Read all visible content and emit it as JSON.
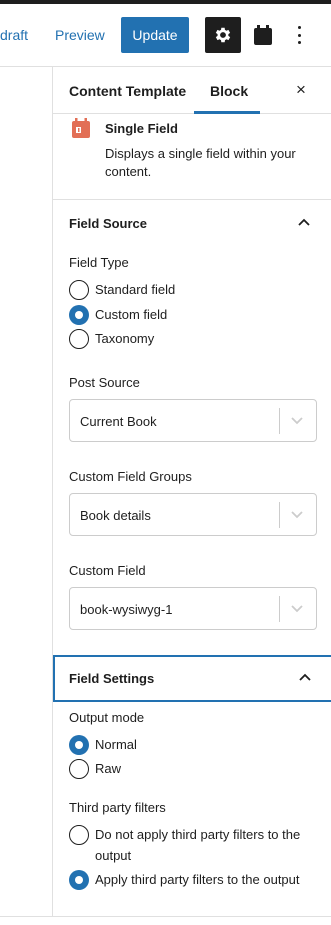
{
  "toolbar": {
    "draft_label": "draft",
    "preview_label": "Preview",
    "update_label": "Update"
  },
  "sidebar": {
    "tabs": [
      {
        "label": "Content Template",
        "active": false
      },
      {
        "label": "Block",
        "active": true
      }
    ],
    "close_icon": "×"
  },
  "block": {
    "icon": "single-field-icon",
    "icon_color": "#e26f56",
    "title": "Single Field",
    "description": "Displays a single field within your content."
  },
  "field_source": {
    "title": "Field Source",
    "field_type_label": "Field Type",
    "field_type_options": [
      {
        "label": "Standard field",
        "checked": false
      },
      {
        "label": "Custom field",
        "checked": true
      },
      {
        "label": "Taxonomy",
        "checked": false
      }
    ],
    "post_source_label": "Post Source",
    "post_source_value": "Current Book",
    "custom_field_groups_label": "Custom Field Groups",
    "custom_field_groups_value": "Book details",
    "custom_field_label": "Custom Field",
    "custom_field_value": "book-wysiwyg-1"
  },
  "field_settings": {
    "title": "Field Settings",
    "output_mode_label": "Output mode",
    "output_mode_options": [
      {
        "label": "Normal",
        "checked": true
      },
      {
        "label": "Raw",
        "checked": false
      }
    ],
    "third_party_label": "Third party filters",
    "third_party_options": [
      {
        "label": "Do not apply third party filters to the output",
        "checked": false
      },
      {
        "label": "Apply third party filters to the output",
        "checked": true
      }
    ]
  },
  "colors": {
    "accent": "#2271b1",
    "dark": "#1e1e1e",
    "border": "#e0e0e0"
  }
}
